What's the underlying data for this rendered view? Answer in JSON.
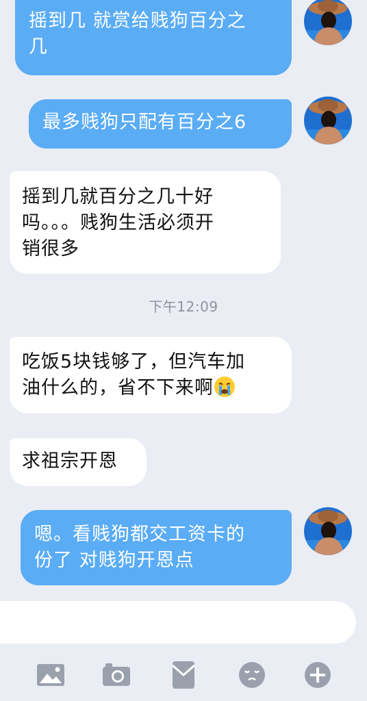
{
  "messages": [
    {
      "id": "m1",
      "direction": "out",
      "text": "摇到几 就赏给贱狗百分之几",
      "lines": [
        "摇到几 就赏给贱狗百分之",
        "几"
      ]
    },
    {
      "id": "m2",
      "direction": "out",
      "text": "最多贱狗只配有百分之6",
      "lines": [
        "最多贱狗只配有百分之6"
      ]
    },
    {
      "id": "m3",
      "direction": "in",
      "text": "摇到几就百分之几十好吗。。。贱狗生活必须开销很多",
      "lines": [
        "摇到几就百分之几十好",
        "吗。。。贱狗生活必须开",
        "销很多"
      ]
    },
    {
      "id": "m4",
      "direction": "in",
      "text": "吃饭5块钱够了，但汽车加油什么的，省不下来啊",
      "lines": [
        "吃饭5块钱够了，但汽车加",
        "油什么的，省不下来啊"
      ],
      "emoji": "crying-face-emoji"
    },
    {
      "id": "m5",
      "direction": "in",
      "text": "求祖宗开恩",
      "lines": [
        "求祖宗开恩"
      ]
    },
    {
      "id": "m6",
      "direction": "out",
      "text": "嗯。看贱狗都交工资卡的份了  对贱狗开恩点",
      "lines": [
        "嗯。看贱狗都交工资卡的",
        "份了  对贱狗开恩点"
      ]
    }
  ],
  "timestamp": "下午12:09",
  "colors": {
    "background": "#eaedf3",
    "outgoing_bubble": "#5aacf5",
    "incoming_bubble": "#ffffff",
    "toolbar_icon": "#9aa1ad"
  },
  "toolbar": {
    "icons": [
      "image-icon",
      "camera-icon",
      "red-packet-icon",
      "emoji-icon",
      "plus-icon"
    ]
  }
}
